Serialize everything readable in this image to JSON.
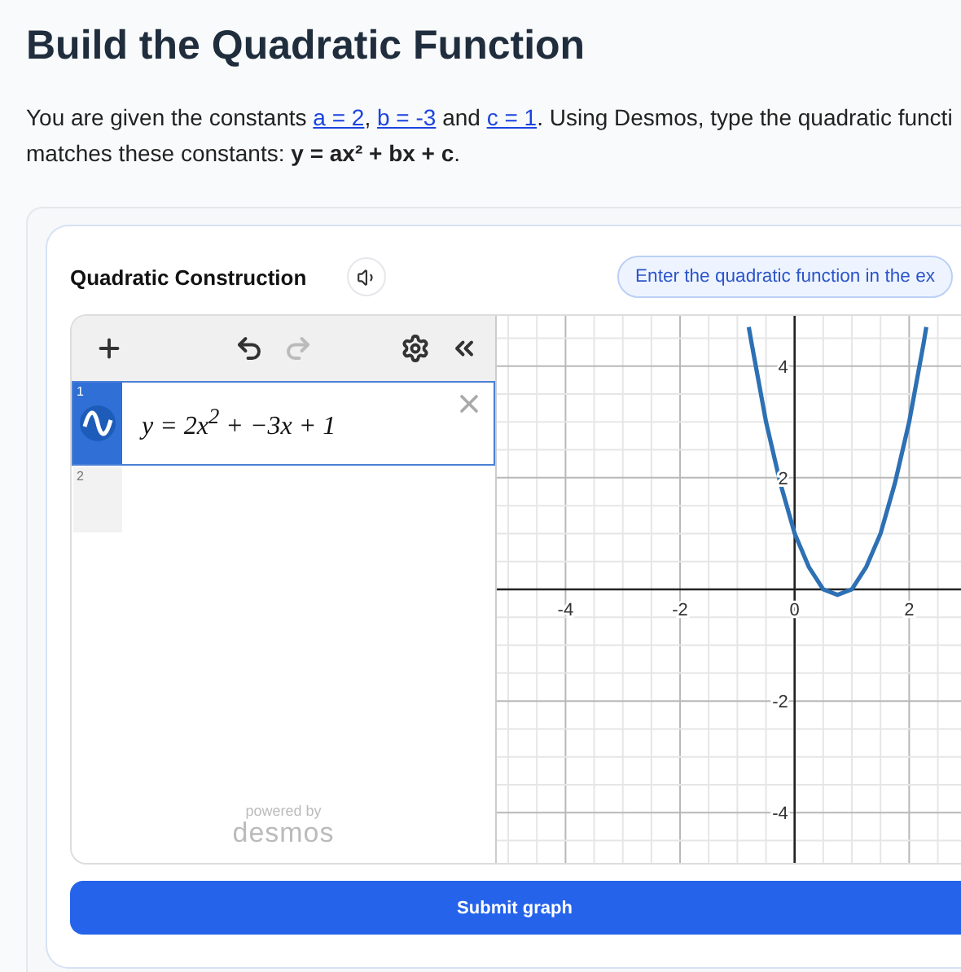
{
  "title": "Build the Quadratic Function",
  "intro": {
    "before": "You are given the constants",
    "links": [
      "a = 2",
      "b = -3",
      "c = 1"
    ],
    "separator": ",",
    "joiner": "and",
    "after": ". Using Desmos, type the quadratic functi",
    "line2": "matches these constants: **y = ax² + bx + c**."
  },
  "activity": {
    "title": "Quadratic Construction",
    "hint": "Enter the quadratic function in the ex"
  },
  "calculator": {
    "toolbar": [
      {
        "kind": "add",
        "disabled": false
      },
      {
        "kind": "undo",
        "disabled": false
      },
      {
        "kind": "redo",
        "disabled": true
      },
      {
        "kind": "settings",
        "disabled": false
      },
      {
        "kind": "collapse",
        "disabled": false
      }
    ],
    "expressions": [
      {
        "index": "1",
        "latex": "y = 2x$^{2}$ + −3x + 1",
        "selected": true
      },
      {
        "index": "2",
        "selected": false
      }
    ],
    "powered": "powered by",
    "brand": "desmos",
    "chart_data": {
      "type": "line",
      "x": [
        -0.8,
        -0.75,
        -0.5,
        -0.25,
        0,
        0.25,
        0.5,
        0.75,
        1,
        1.25,
        1.5,
        1.75,
        2,
        2.25,
        2.3
      ],
      "series": [
        {
          "color": "#2d70b3",
          "values": [
            4.7,
            4.4,
            3,
            1.9,
            1,
            0.4,
            0,
            -0.1,
            0,
            0.4,
            1,
            1.9,
            3,
            4.4,
            4.7
          ]
        }
      ],
      "xlim": [
        -5.2,
        3.9
      ],
      "ylim": [
        -4.9,
        4.9
      ],
      "grid": true,
      "xticks": [
        -4,
        -2,
        0,
        2
      ],
      "yticks": [
        -4,
        -2,
        2,
        4
      ]
    }
  },
  "submit": "Submit graph"
}
